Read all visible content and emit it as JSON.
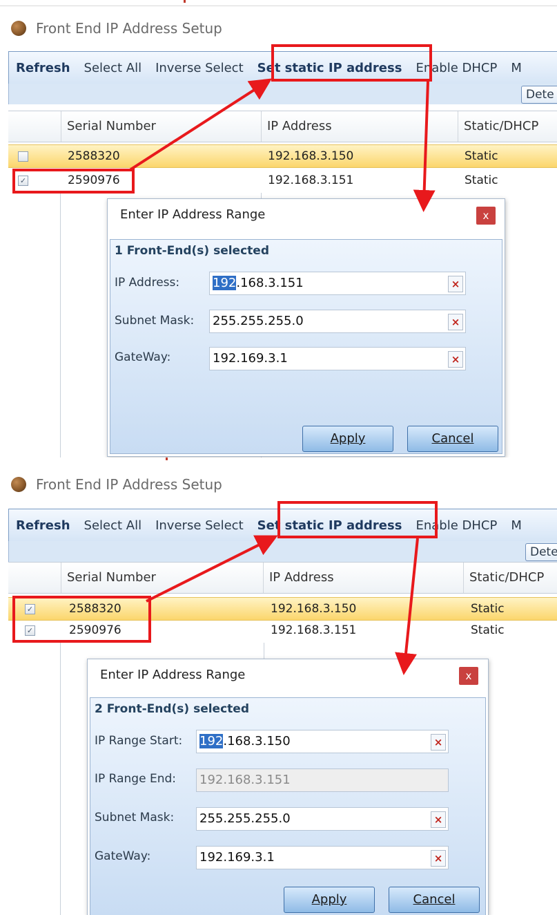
{
  "window_title": "Front End IP Address Setup",
  "toolbar": {
    "refresh": "Refresh",
    "select_all": "Select All",
    "inverse_select": "Inverse Select",
    "set_static_ip": "Set static IP address",
    "enable_dhcp": "Enable DHCP",
    "overflow_label": "M"
  },
  "detect_button": "Dete",
  "grid": {
    "columns": [
      "Serial Number",
      "IP Address",
      "Static/DHCP"
    ],
    "rows": [
      {
        "serial": "2588320",
        "ip": "192.168.3.150",
        "mode": "Static"
      },
      {
        "serial": "2590976",
        "ip": "192.168.3.151",
        "mode": "Static"
      }
    ]
  },
  "dialog_single": {
    "title": "Enter IP Address Range",
    "close": "x",
    "heading": "1 Front-End(s) selected",
    "fields": [
      {
        "label": "IP Address:",
        "value_selected": "192",
        "value_rest": ".168.3.151",
        "clear": "×"
      },
      {
        "label": "Subnet Mask:",
        "value": "255.255.255.0",
        "clear": "×"
      },
      {
        "label": "GateWay:",
        "value": "192.169.3.1",
        "clear": "×"
      }
    ],
    "apply": "Apply",
    "cancel": "Cancel"
  },
  "dialog_range": {
    "title": "Enter IP Address Range",
    "close": "x",
    "heading": "2 Front-End(s) selected",
    "fields": [
      {
        "label": "IP Range Start:",
        "value_selected": "192",
        "value_rest": ".168.3.150",
        "clear": "×"
      },
      {
        "label": "IP Range End:",
        "value": "192.168.3.151"
      },
      {
        "label": "Subnet Mask:",
        "value": "255.255.255.0",
        "clear": "×"
      },
      {
        "label": "GateWay:",
        "value": "192.169.3.1",
        "clear": "×"
      }
    ],
    "apply": "Apply",
    "cancel": "Cancel"
  },
  "top_panel_checks": [
    "",
    "✓"
  ],
  "bottom_panel_checks": [
    "✓",
    "✓"
  ],
  "colors": {
    "callout_red": "#e8191c",
    "selected_row": "#fbd66c",
    "toolbar_blue": "#d6e5f6",
    "dialog_blue": "#c8dcf3",
    "close_red": "#c9413f"
  }
}
